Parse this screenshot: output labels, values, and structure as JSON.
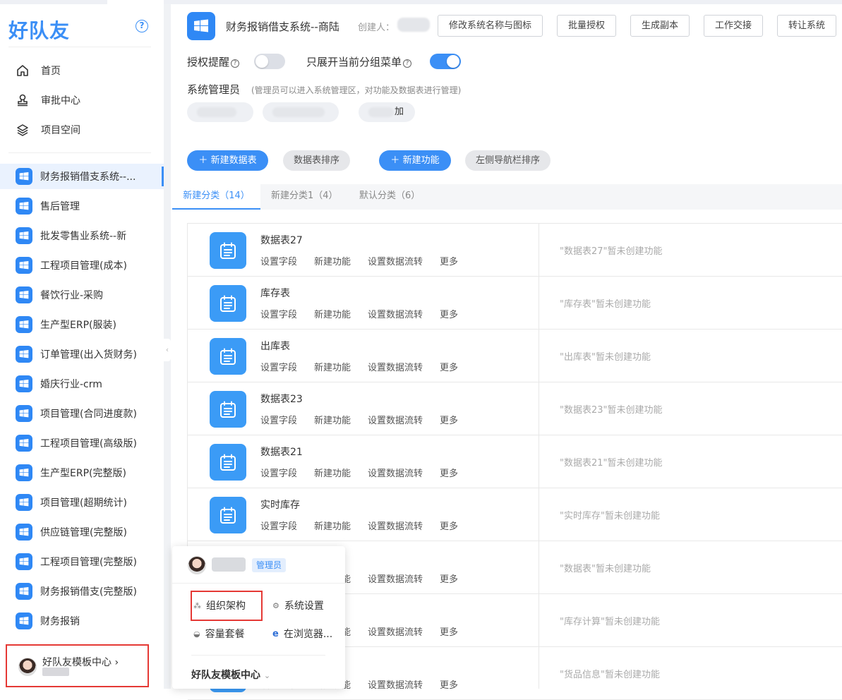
{
  "sidebar": {
    "logo": "好队友",
    "nav": [
      {
        "label": "首页",
        "icon": "home-icon"
      },
      {
        "label": "审批中心",
        "icon": "stamp-icon"
      },
      {
        "label": "项目空间",
        "icon": "layers-icon"
      }
    ],
    "apps": [
      "财务报销借支系统--...",
      "售后管理",
      "批发零售业系统--新",
      "工程项目管理(成本)",
      "餐饮行业-采购",
      "生产型ERP(服装)",
      "订单管理(出入货财务)",
      "婚庆行业-crm",
      "项目管理(合同进度款)",
      "工程项目管理(高级版)",
      "生产型ERP(完整版)",
      "项目管理(超期统计)",
      "供应链管理(完整版)",
      "工程项目管理(完整版)",
      "财务报销借支(完整版)",
      "财务报销"
    ],
    "user": {
      "name": "好队友模板中心",
      "chevron": "›"
    }
  },
  "header": {
    "title": "财务报销借支系统--商陆",
    "creator_label": "创建人：",
    "buttons": [
      "修改系统名称与图标",
      "批量授权",
      "生成副本",
      "工作交接",
      "转让系统"
    ]
  },
  "settings": {
    "auth_reminder": {
      "label": "授权提醒",
      "on": false
    },
    "expand_group": {
      "label": "只展开当前分组菜单",
      "on": true
    },
    "admin_label": "系统管理员",
    "admin_hint": "(管理员可以进入系统管理区，对功能及数据表进行管理)",
    "admin_chip_suffix": "加"
  },
  "toolbar": {
    "new_table": "新建数据表",
    "sort_tables": "数据表排序",
    "new_function": "新建功能",
    "sort_nav": "左侧导航栏排序"
  },
  "tabs": [
    "新建分类（14）",
    "新建分类1（4）",
    "默认分类（6）"
  ],
  "row_actions": [
    "设置字段",
    "新建功能",
    "设置数据流转",
    "更多"
  ],
  "tables": [
    {
      "name": "数据表27",
      "empty": "\"数据表27\"暂未创建功能"
    },
    {
      "name": "库存表",
      "empty": "\"库存表\"暂未创建功能"
    },
    {
      "name": "出库表",
      "empty": "\"出库表\"暂未创建功能"
    },
    {
      "name": "数据表23",
      "empty": "\"数据表23\"暂未创建功能"
    },
    {
      "name": "数据表21",
      "empty": "\"数据表21\"暂未创建功能"
    },
    {
      "name": "实时库存",
      "empty": "\"实时库存\"暂未创建功能"
    },
    {
      "name": "",
      "empty": "\"数据表\"暂未创建功能"
    },
    {
      "name": "",
      "empty": "\"库存计算\"暂未创建功能"
    },
    {
      "name": "",
      "empty": "\"货品信息\"暂未创建功能"
    }
  ],
  "popup": {
    "badge": "管理员",
    "items": [
      {
        "label": "组织架构",
        "icon": "org-icon"
      },
      {
        "label": "系统设置",
        "icon": "gear-icon"
      },
      {
        "label": "容量套餐",
        "icon": "storage-icon"
      },
      {
        "label": "在浏览器...",
        "icon": "ie-icon"
      }
    ],
    "footer": "好队友模板中心"
  },
  "colors": {
    "accent": "#3b8ff6",
    "highlight_border": "#e53935"
  }
}
